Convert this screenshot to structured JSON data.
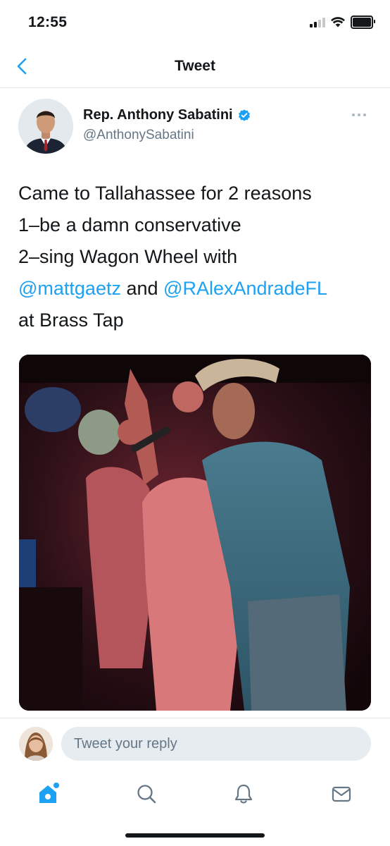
{
  "status_bar": {
    "time": "12:55"
  },
  "nav": {
    "title": "Tweet"
  },
  "tweet": {
    "author_name": "Rep. Anthony Sabatini",
    "author_handle": "@AnthonySabatini",
    "verified": true,
    "text_lines": [
      "Came to Tallahassee for 2 reasons",
      "1–be a damn conservative",
      "2–sing Wagon Wheel with"
    ],
    "mention_1": "@mattgaetz",
    "connector": " and ",
    "mention_2": "@RAlexAndradeFL",
    "last_line": "at Brass Tap"
  },
  "reply": {
    "placeholder": "Tweet your reply"
  },
  "tabs": [
    "home-icon",
    "search-icon",
    "notifications-icon",
    "messages-icon"
  ],
  "colors": {
    "accent": "#1da1f2",
    "text": "#14171a",
    "secondary": "#657786",
    "input_bg": "#e6ecf0"
  }
}
